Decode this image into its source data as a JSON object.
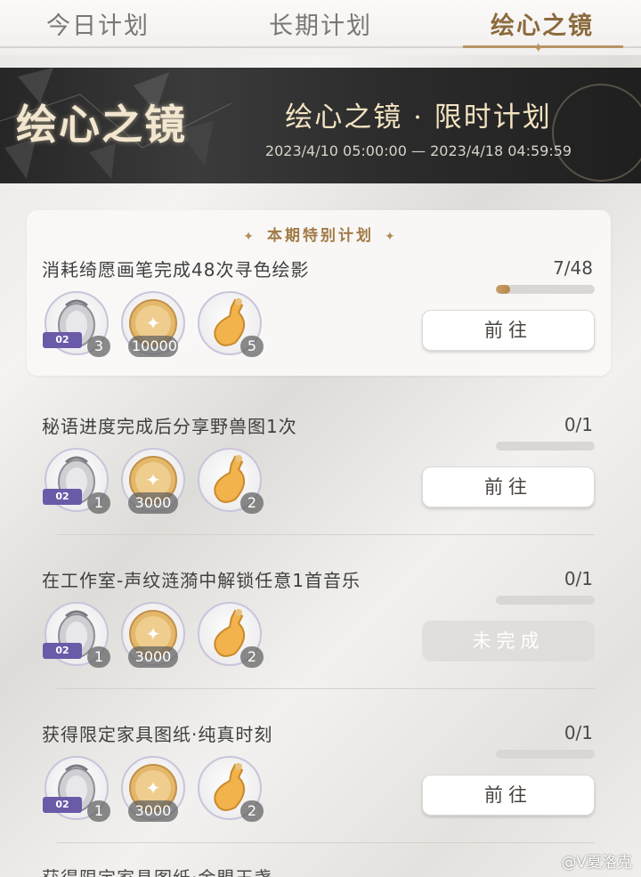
{
  "tabs": [
    {
      "label": "今日计划"
    },
    {
      "label": "长期计划"
    },
    {
      "label": "绘心之镜"
    }
  ],
  "banner": {
    "logo": "绘心之镜",
    "title": "绘心之镜 · 限时计划",
    "dates": "2023/4/10 05:00:00 — 2023/4/18 04:59:59"
  },
  "featured_header": "本期特别计划",
  "tasks": [
    {
      "title": "消耗绮愿画笔完成48次寻色绘影",
      "progress": "7/48",
      "progress_fraction": 0.146,
      "rewards": [
        {
          "icon": "outfit-ticket-icon",
          "ticket": "02",
          "count": "3"
        },
        {
          "icon": "gold-coin-icon",
          "count": "10000"
        },
        {
          "icon": "potion-bottle-icon",
          "count": "5"
        }
      ],
      "button": "前往"
    },
    {
      "title": "秘语进度完成后分享野兽图1次",
      "progress": "0/1",
      "progress_fraction": 0,
      "rewards": [
        {
          "icon": "outfit-ticket-icon",
          "ticket": "02",
          "count": "1"
        },
        {
          "icon": "gold-coin-icon",
          "count": "3000"
        },
        {
          "icon": "potion-bottle-icon",
          "count": "2"
        }
      ],
      "button": "前往"
    },
    {
      "title": "在工作室-声纹涟漪中解锁任意1首音乐",
      "progress": "0/1",
      "progress_fraction": 0,
      "rewards": [
        {
          "icon": "outfit-ticket-icon",
          "ticket": "02",
          "count": "1"
        },
        {
          "icon": "gold-coin-icon",
          "count": "3000"
        },
        {
          "icon": "potion-bottle-icon",
          "count": "2"
        }
      ],
      "button": "未完成"
    },
    {
      "title": "获得限定家具图纸·纯真时刻",
      "progress": "0/1",
      "progress_fraction": 0,
      "rewards": [
        {
          "icon": "outfit-ticket-icon",
          "ticket": "02",
          "count": "1"
        },
        {
          "icon": "gold-coin-icon",
          "count": "3000"
        },
        {
          "icon": "potion-bottle-icon",
          "count": "2"
        }
      ],
      "button": "前往"
    }
  ],
  "next_task_partial": "获得限定家具图纸·金盟玉盏",
  "watermark": "@V夏洛克",
  "colors": {
    "accent": "#b89364",
    "progress_fill": "#c7a06a",
    "ticket": "#6a5aa8"
  }
}
